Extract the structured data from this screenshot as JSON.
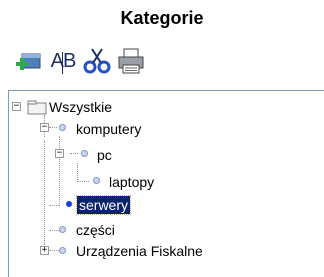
{
  "panel": {
    "title": "Kategorie"
  },
  "toolbar": {
    "buttons": [
      {
        "icon": "add-category-icon"
      },
      {
        "icon": "rename-icon",
        "glyph": "AB"
      },
      {
        "icon": "cut-icon"
      },
      {
        "icon": "print-icon"
      }
    ]
  },
  "tree": {
    "root": {
      "label": "Wszystkie",
      "expander": "−"
    },
    "komputery": {
      "label": "komputery",
      "expander": "−"
    },
    "pc": {
      "label": "pc",
      "expander": "−"
    },
    "laptopy": {
      "label": "laptopy"
    },
    "serwery": {
      "label": "serwery",
      "selected": true
    },
    "czesci": {
      "label": "części"
    },
    "fiskalne": {
      "label": "Urządzenia Fiskalne",
      "expander": "+"
    }
  },
  "colors": {
    "selection": "#0a246a",
    "border": "#7f9db9",
    "active_dot": "#1a3fd6"
  }
}
